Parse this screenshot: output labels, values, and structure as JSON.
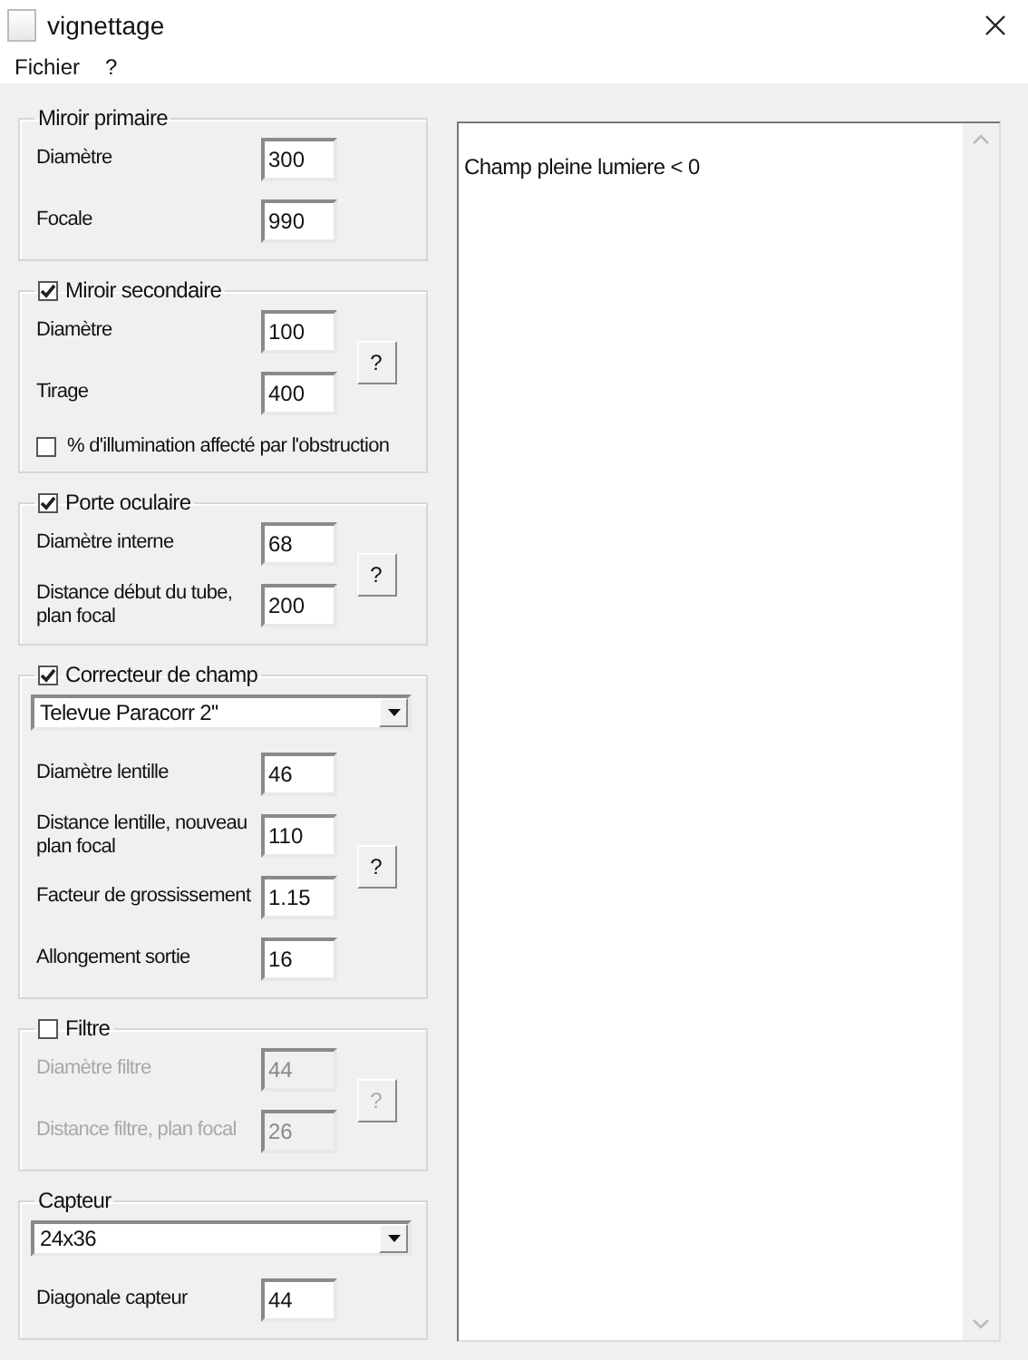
{
  "window": {
    "title": "vignettage"
  },
  "menu": [
    {
      "label": "Fichier"
    },
    {
      "label": "?"
    }
  ],
  "groups": [
    {
      "title": "Miroir primaire",
      "fields": [
        {
          "label": "Diamètre",
          "value": "300",
          "disabled": false
        },
        {
          "label": "Focale",
          "value": "990",
          "disabled": false
        }
      ]
    },
    {
      "title": "Miroir secondaire",
      "checked": true,
      "fields": [
        {
          "label": "Diamètre",
          "value": "100",
          "disabled": false
        },
        {
          "label": "Tirage",
          "value": "400",
          "disabled": false
        }
      ],
      "help_button": {
        "label": "?",
        "disabled": false
      },
      "options": [
        {
          "label": "% d'illumination affecté par l'obstruction",
          "checked": false
        }
      ]
    },
    {
      "title": "Porte oculaire",
      "checked": true,
      "fields": [
        {
          "label": "Diamètre interne",
          "value": "68",
          "disabled": false
        },
        {
          "label": "Distance début du tube, plan focal",
          "value": "200",
          "disabled": false
        }
      ],
      "help_button": {
        "label": "?",
        "disabled": false
      }
    },
    {
      "title": "Correcteur de champ",
      "checked": true,
      "dropdown": {
        "value": "Televue Paracorr 2''"
      },
      "fields": [
        {
          "label": "Diamètre lentille",
          "value": "46",
          "disabled": false
        },
        {
          "label": "Distance lentille, nouveau plan focal",
          "value": "110",
          "disabled": false
        },
        {
          "label": "Facteur de grossissement",
          "value": "1.15",
          "disabled": false
        },
        {
          "label": "Allongement sortie",
          "value": "16",
          "disabled": false
        }
      ],
      "help_button": {
        "label": "?",
        "disabled": false
      }
    },
    {
      "title": "Filtre",
      "checked": false,
      "fields": [
        {
          "label": "Diamètre filtre",
          "value": "44",
          "disabled": true
        },
        {
          "label": "Distance filtre, plan focal",
          "value": "26",
          "disabled": true
        }
      ],
      "help_button": {
        "label": "?",
        "disabled": true
      }
    },
    {
      "title": "Capteur",
      "dropdown": {
        "value": "24x36"
      },
      "fields": [
        {
          "label": "Diagonale capteur",
          "value": "44",
          "disabled": false
        }
      ]
    }
  ],
  "output": {
    "text": "Champ pleine lumiere < 0"
  }
}
